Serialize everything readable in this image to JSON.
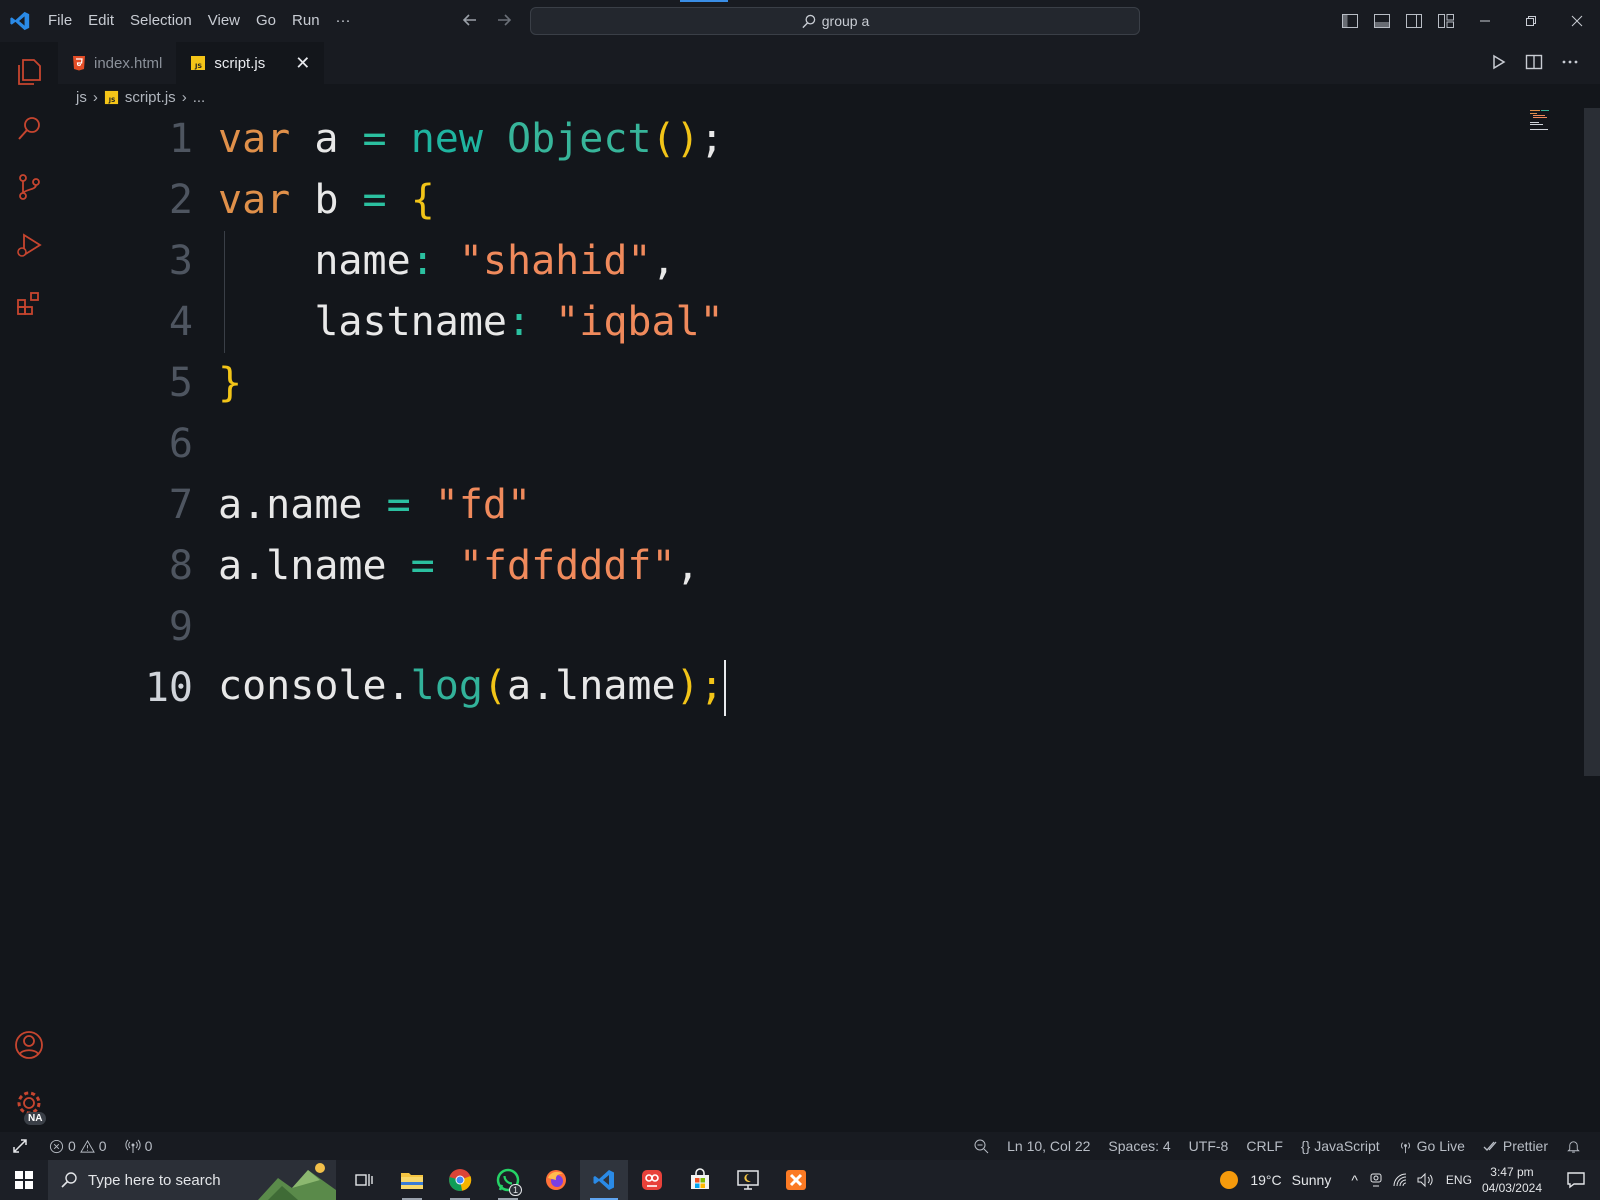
{
  "menu": [
    "File",
    "Edit",
    "Selection",
    "View",
    "Go",
    "Run",
    "···"
  ],
  "search": {
    "text": "group a"
  },
  "tabs": [
    {
      "label": "index.html",
      "icon": "html5-icon"
    },
    {
      "label": "script.js",
      "icon": "js-icon",
      "close": "✕"
    }
  ],
  "breadcrumb": {
    "folder": "js",
    "file": "script.js",
    "more": "..."
  },
  "line_numbers": [
    "1",
    "2",
    "3",
    "4",
    "5",
    "6",
    "7",
    "8",
    "9",
    "10"
  ],
  "code": {
    "l1": [
      "var",
      " a ",
      "=",
      " ",
      "new",
      " ",
      "Object",
      "()",
      ";"
    ],
    "l2": [
      "var",
      " b ",
      "=",
      " ",
      "{"
    ],
    "l3": [
      "    name",
      ":",
      " ",
      "\"shahid\"",
      ","
    ],
    "l4": [
      "    lastname",
      ":",
      " ",
      "\"iqbal\""
    ],
    "l5": [
      "}"
    ],
    "l7": [
      "a.name ",
      "=",
      " ",
      "\"fd\""
    ],
    "l8": [
      "a.lname ",
      "=",
      " ",
      "\"fdfdddf\"",
      ","
    ],
    "l10": [
      "console.",
      "log",
      "(",
      "a.lname",
      ")",
      ";"
    ]
  },
  "status": {
    "errors": "0",
    "warnings": "0",
    "ports": "0",
    "position": "Ln 10, Col 22",
    "spaces": "Spaces: 4",
    "encoding": "UTF-8",
    "eol": "CRLF",
    "language": "JavaScript",
    "golive": "Go Live",
    "prettier": "Prettier"
  },
  "activity": {
    "badge": "NA"
  },
  "taskbar": {
    "search_placeholder": "Type here to search",
    "weather": "19°C",
    "weather_text": "Sunny",
    "lang": "ENG",
    "time": "3:47 pm",
    "date": "04/03/2024",
    "whatsapp_badge": "1"
  },
  "colors": {
    "accent": "#3a8ee6",
    "keyword": "#e0904a",
    "string": "#f08a5c",
    "bracket": "#f2c418",
    "type": "#37b59a"
  }
}
